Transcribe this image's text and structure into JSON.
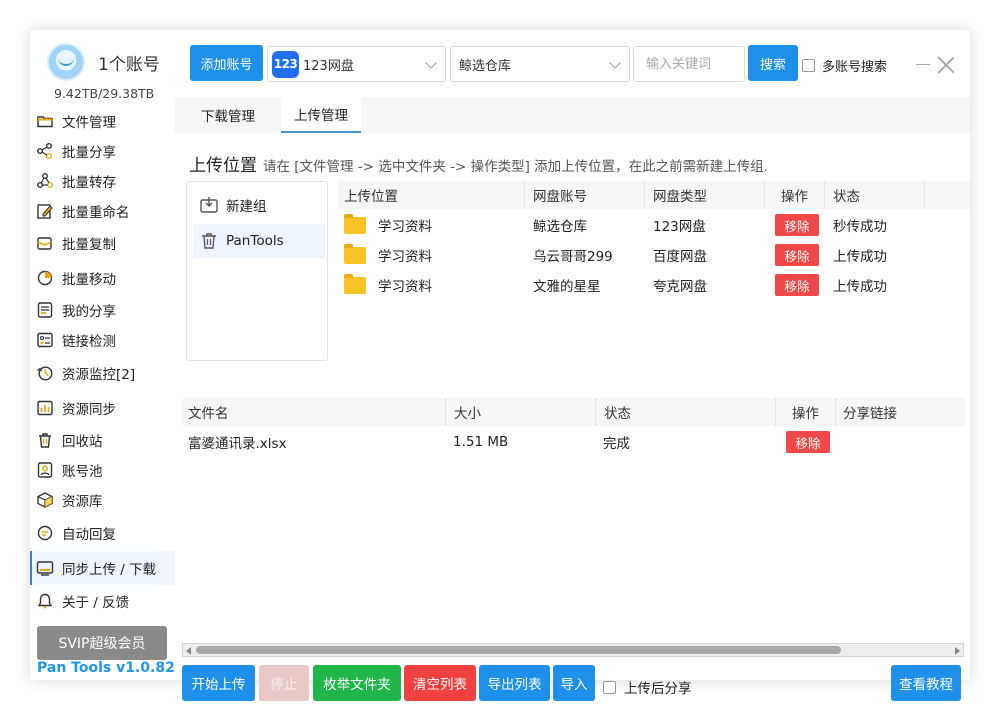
{
  "account": {
    "title": "1个账号",
    "storage": "9.42TB/29.38TB"
  },
  "sidebar": {
    "items": [
      {
        "label": "文件管理",
        "icon": "folder-icon"
      },
      {
        "label": "批量分享",
        "icon": "share-icon"
      },
      {
        "label": "批量转存",
        "icon": "transfer-icon"
      },
      {
        "label": "批量重命名",
        "icon": "rename-icon"
      },
      {
        "label": "批量复制",
        "icon": "copy-icon"
      },
      {
        "label": "批量移动",
        "icon": "move-icon"
      },
      {
        "label": "我的分享",
        "icon": "my-share-icon"
      },
      {
        "label": "链接检测",
        "icon": "link-check-icon"
      },
      {
        "label": "资源监控[2]",
        "icon": "monitor-icon"
      },
      {
        "label": "资源同步",
        "icon": "sync-icon"
      },
      {
        "label": "回收站",
        "icon": "trash-icon"
      },
      {
        "label": "账号池",
        "icon": "account-pool-icon"
      },
      {
        "label": "资源库",
        "icon": "resource-box-icon"
      },
      {
        "label": "自动回复",
        "icon": "auto-reply-icon"
      },
      {
        "label": "同步上传 / 下载",
        "icon": "upload-download-icon"
      },
      {
        "label": "关于 / 反馈",
        "icon": "bell-icon"
      }
    ],
    "active_index": 14,
    "svip_label": "SVIP超级会员",
    "version": "Pan Tools v1.0.82"
  },
  "toolbar": {
    "add_account": "添加账号",
    "pan_logo": "123",
    "pan_selected": "123网盘",
    "repo_selected": "鲸选仓库",
    "search_placeholder": "输入关键词",
    "search_label": "搜索",
    "multi_search_label": "多账号搜索"
  },
  "tabs": [
    {
      "label": "下载管理"
    },
    {
      "label": "上传管理"
    }
  ],
  "upload": {
    "heading": "上传位置",
    "hint": "请在 [文件管理 -> 选中文件夹 -> 操作类型] 添加上传位置，在此之前需新建上传组.",
    "groups": [
      {
        "label": "新建组",
        "icon": "new-group-icon"
      },
      {
        "label": "PanTools",
        "icon": "trash-icon"
      }
    ],
    "location_columns": [
      "上传位置",
      "网盘账号",
      "网盘类型",
      "操作",
      "状态"
    ],
    "locations": [
      {
        "folder": "学习资料",
        "account": "鲸选仓库",
        "type": "123网盘",
        "action": "移除",
        "status": "秒传成功"
      },
      {
        "folder": "学习资料",
        "account": "乌云哥哥299",
        "type": "百度网盘",
        "action": "移除",
        "status": "上传成功"
      },
      {
        "folder": "学习资料",
        "account": "文雅的星星",
        "type": "夸克网盘",
        "action": "移除",
        "status": "上传成功"
      }
    ],
    "file_columns": [
      "文件名",
      "大小",
      "状态",
      "操作",
      "分享链接"
    ],
    "files": [
      {
        "name": "富婆通讯录.xlsx",
        "size": "1.51 MB",
        "status": "完成",
        "action": "移除",
        "link": ""
      }
    ]
  },
  "bottom": {
    "start": "开始上传",
    "stop": "停止",
    "enumerate": "枚举文件夹",
    "clear": "清空列表",
    "export": "导出列表",
    "import": "导入",
    "share_after": "上传后分享",
    "tutorial": "查看教程"
  },
  "colors": {
    "primary": "#1e90ea",
    "danger": "#f04848",
    "success": "#22b64a",
    "accent_text": "#2196e8"
  }
}
